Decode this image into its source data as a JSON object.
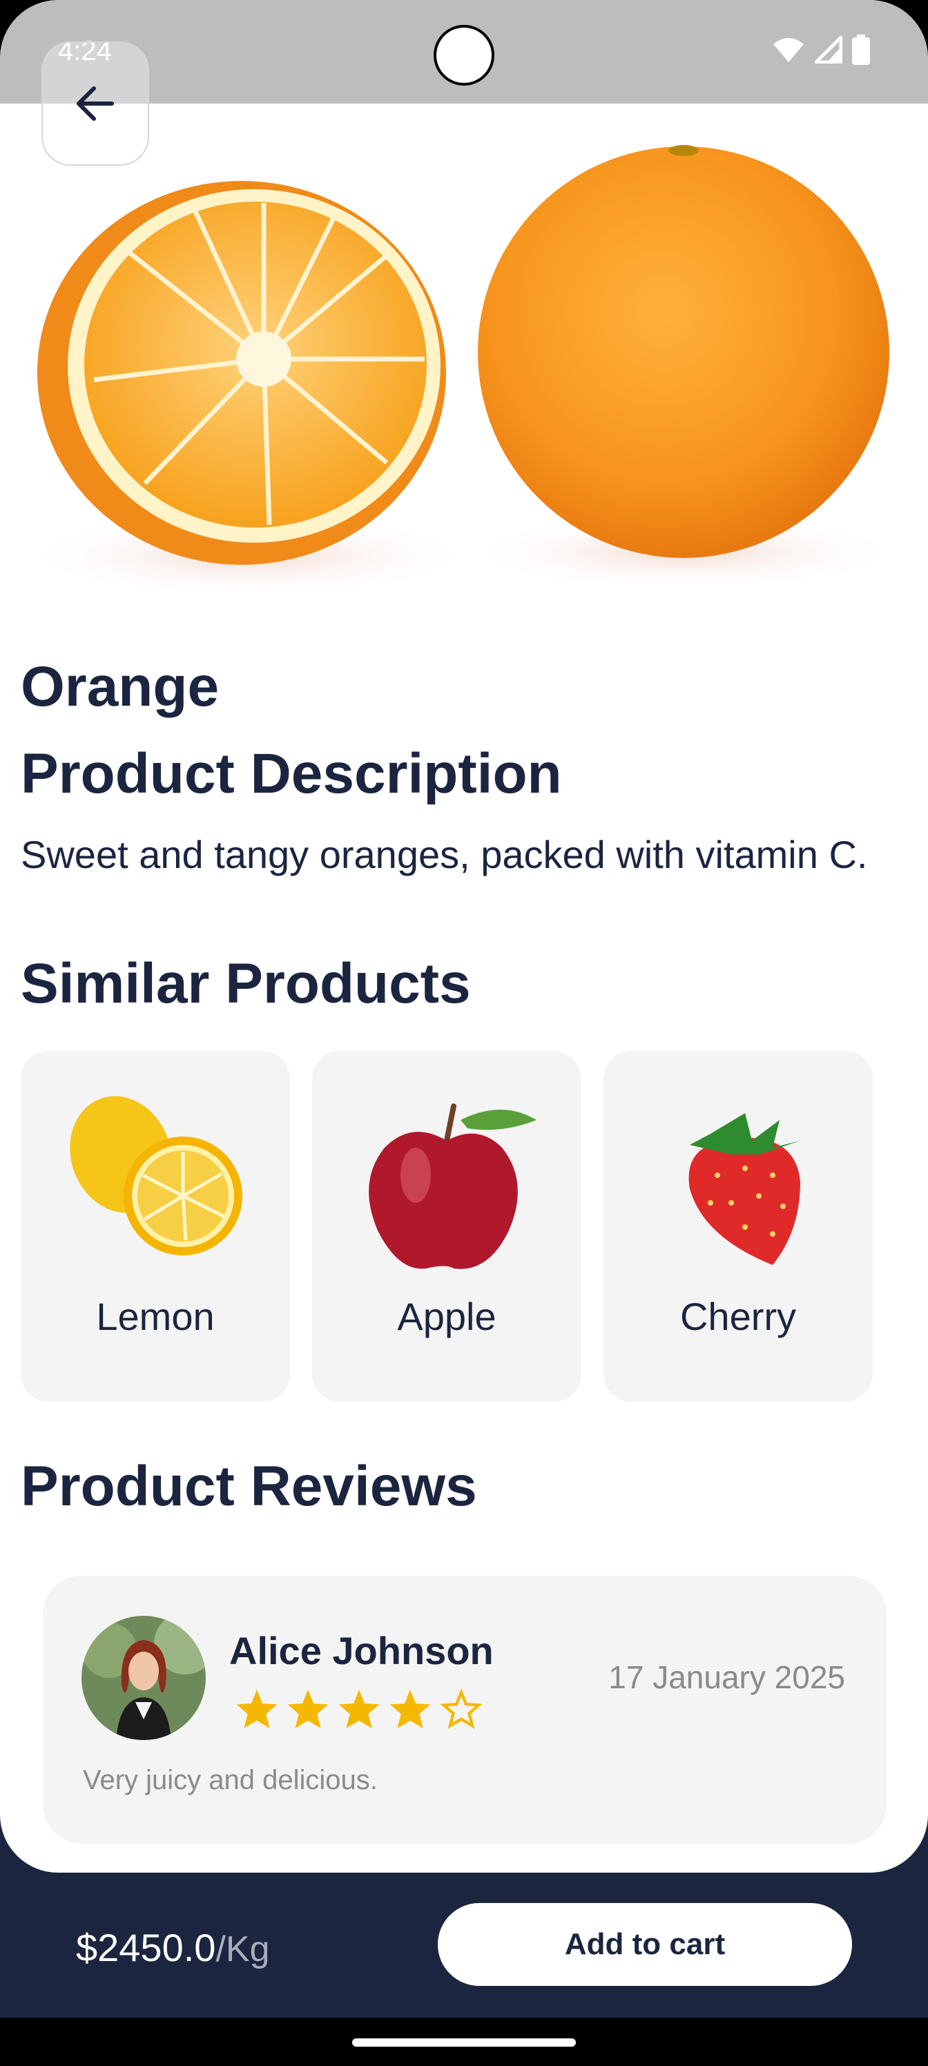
{
  "status": {
    "time": "4:24",
    "icons": [
      "wifi-icon",
      "signal-icon",
      "battery-icon"
    ]
  },
  "back": {
    "icon": "arrow-left-icon"
  },
  "product": {
    "name": "Orange",
    "description_heading": "Product Description",
    "description": "Sweet and tangy oranges, packed with vitamin C."
  },
  "similar": {
    "heading": "Similar Products",
    "items": [
      {
        "label": "Lemon"
      },
      {
        "label": "Apple"
      },
      {
        "label": "Cherry"
      }
    ]
  },
  "reviews": {
    "heading": "Product Reviews",
    "items": [
      {
        "name": "Alice Johnson",
        "rating": 4,
        "max_rating": 5,
        "date": "17 January 2025",
        "text": "Very juicy and delicious."
      }
    ]
  },
  "footer": {
    "price": "$2450.0",
    "unit": "/Kg",
    "add_to_cart": "Add to cart"
  },
  "colors": {
    "primary": "#1b2540",
    "star": "#f5b800",
    "card_bg": "#f4f4f4"
  }
}
